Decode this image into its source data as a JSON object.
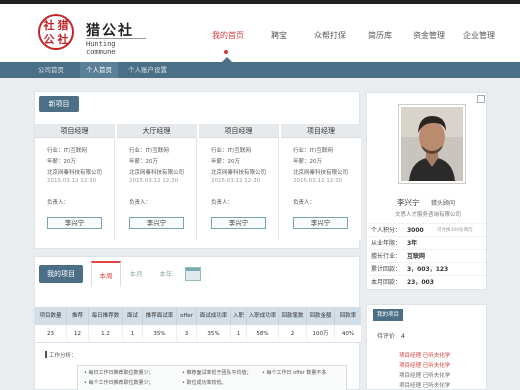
{
  "header": {
    "logo_seal": [
      "社",
      "猎",
      "公",
      "社"
    ],
    "logo_title": "猎公社",
    "logo_subtitle": "Hunting commune",
    "nav": [
      "我的首页",
      "聘宝",
      "众帮打保",
      "简历库",
      "资金管理",
      "企业管理"
    ],
    "nav_active": 0
  },
  "subnav": {
    "items": [
      "公司首页",
      "个人首页",
      "个人账户设置"
    ],
    "active": 1
  },
  "new_projects": {
    "title": "新项目",
    "cards": [
      {
        "title": "项目经理",
        "industry": "行业：IT/互联网",
        "salary": "年薪：20万",
        "company": "北京网秦科技有限公司",
        "date": "2015.03.12  12:30",
        "owner_label": "负责人：",
        "owner": "李兴宁"
      },
      {
        "title": "大厅经理",
        "industry": "行业：IT/互联网",
        "salary": "年薪：20万",
        "company": "北京网秦科技有限公司",
        "date": "2015.03.12  12:30",
        "owner_label": "负责人：",
        "owner": "李兴宁"
      },
      {
        "title": "项目经理",
        "industry": "行业：IT/互联网",
        "salary": "年薪：20万",
        "company": "北京网秦科技有限公司",
        "date": "2015.03.12  12:30",
        "owner_label": "负责人：",
        "owner": "李兴宁"
      },
      {
        "title": "项目经理",
        "industry": "行业：IT/互联网",
        "salary": "年薪：20万",
        "company": "北京网秦科技有限公司",
        "date": "2015.03.12  12:30",
        "owner_label": "负责人：",
        "owner": "李兴宁"
      }
    ]
  },
  "my_projects": {
    "title": "我的项目",
    "tabs": [
      "本周",
      "本月",
      "本年"
    ],
    "active_tab": 0,
    "table": {
      "headers": [
        "项目数量",
        "推荐",
        "每日推荐数",
        "面试",
        "推荐面试率",
        "offer",
        "面试成功率",
        "入职",
        "入职成功率",
        "回款笔数",
        "回款金额",
        "回款率"
      ],
      "row": [
        "23",
        "12",
        "1.2",
        "1",
        "35%",
        "3",
        "35%",
        "1",
        "58%",
        "2",
        "100万",
        "40%"
      ]
    },
    "work_label": "工作分析：",
    "work_lines": [
      "• 每日工作日推荐职位数量少；",
      "• 推荐面试率低于团队平均值；",
      "• 每个工作日 offer 数量不多",
      "• 每个工作日推荐职位数量少；",
      "• 职位成功率较低。"
    ]
  },
  "profile": {
    "name": "李兴宁",
    "role": "猎头顾问",
    "company": "文思人才服务咨询有限公司",
    "stats": [
      {
        "label": "个人积分：",
        "value": "3000",
        "note": "可兑换300份简历"
      },
      {
        "label": "从业年限：",
        "value": "3年",
        "note": ""
      },
      {
        "label": "擅长行业：",
        "value": "互联网",
        "note": ""
      },
      {
        "label": "累计回款：",
        "value": "3，003，123",
        "note": ""
      },
      {
        "label": "本月回款：",
        "value": "23，003",
        "note": ""
      }
    ]
  },
  "my_projects_side": {
    "title": "我的项目",
    "pending_label": "待评价",
    "pending_count": "4",
    "links": [
      {
        "text": "项目经理   已听夫化学",
        "color": "red"
      },
      {
        "text": "项目经理   已听夫化学",
        "color": "red"
      },
      {
        "text": "项目经理   已听夫化学",
        "color": "gray"
      },
      {
        "text": "项目经理   已听夫化学",
        "color": "gray"
      }
    ]
  }
}
